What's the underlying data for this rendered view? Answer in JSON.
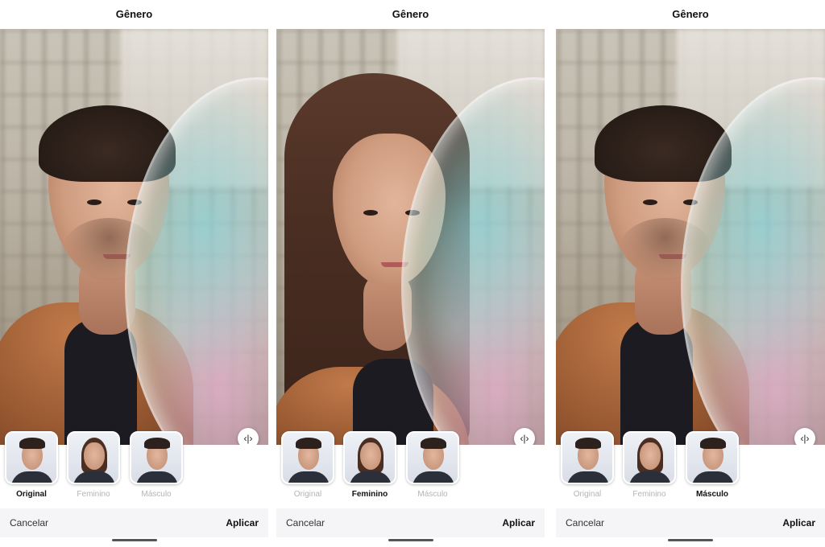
{
  "panels": [
    {
      "title": "Gênero",
      "selected": 0,
      "options": [
        "Original",
        "Feminino",
        "Másculo"
      ],
      "cancel": "Cancelar",
      "apply": "Aplicar",
      "compare_icon": "split-compare-icon"
    },
    {
      "title": "Gênero",
      "selected": 1,
      "options": [
        "Original",
        "Feminino",
        "Másculo"
      ],
      "cancel": "Cancelar",
      "apply": "Aplicar",
      "compare_icon": "split-compare-icon"
    },
    {
      "title": "Gênero",
      "selected": 2,
      "options": [
        "Original",
        "Feminino",
        "Másculo"
      ],
      "cancel": "Cancelar",
      "apply": "Aplicar",
      "compare_icon": "split-compare-icon"
    }
  ],
  "colors": {
    "active_label": "#111111",
    "inactive_label": "#b4b4b4",
    "bar_bg": "#f5f5f7"
  }
}
